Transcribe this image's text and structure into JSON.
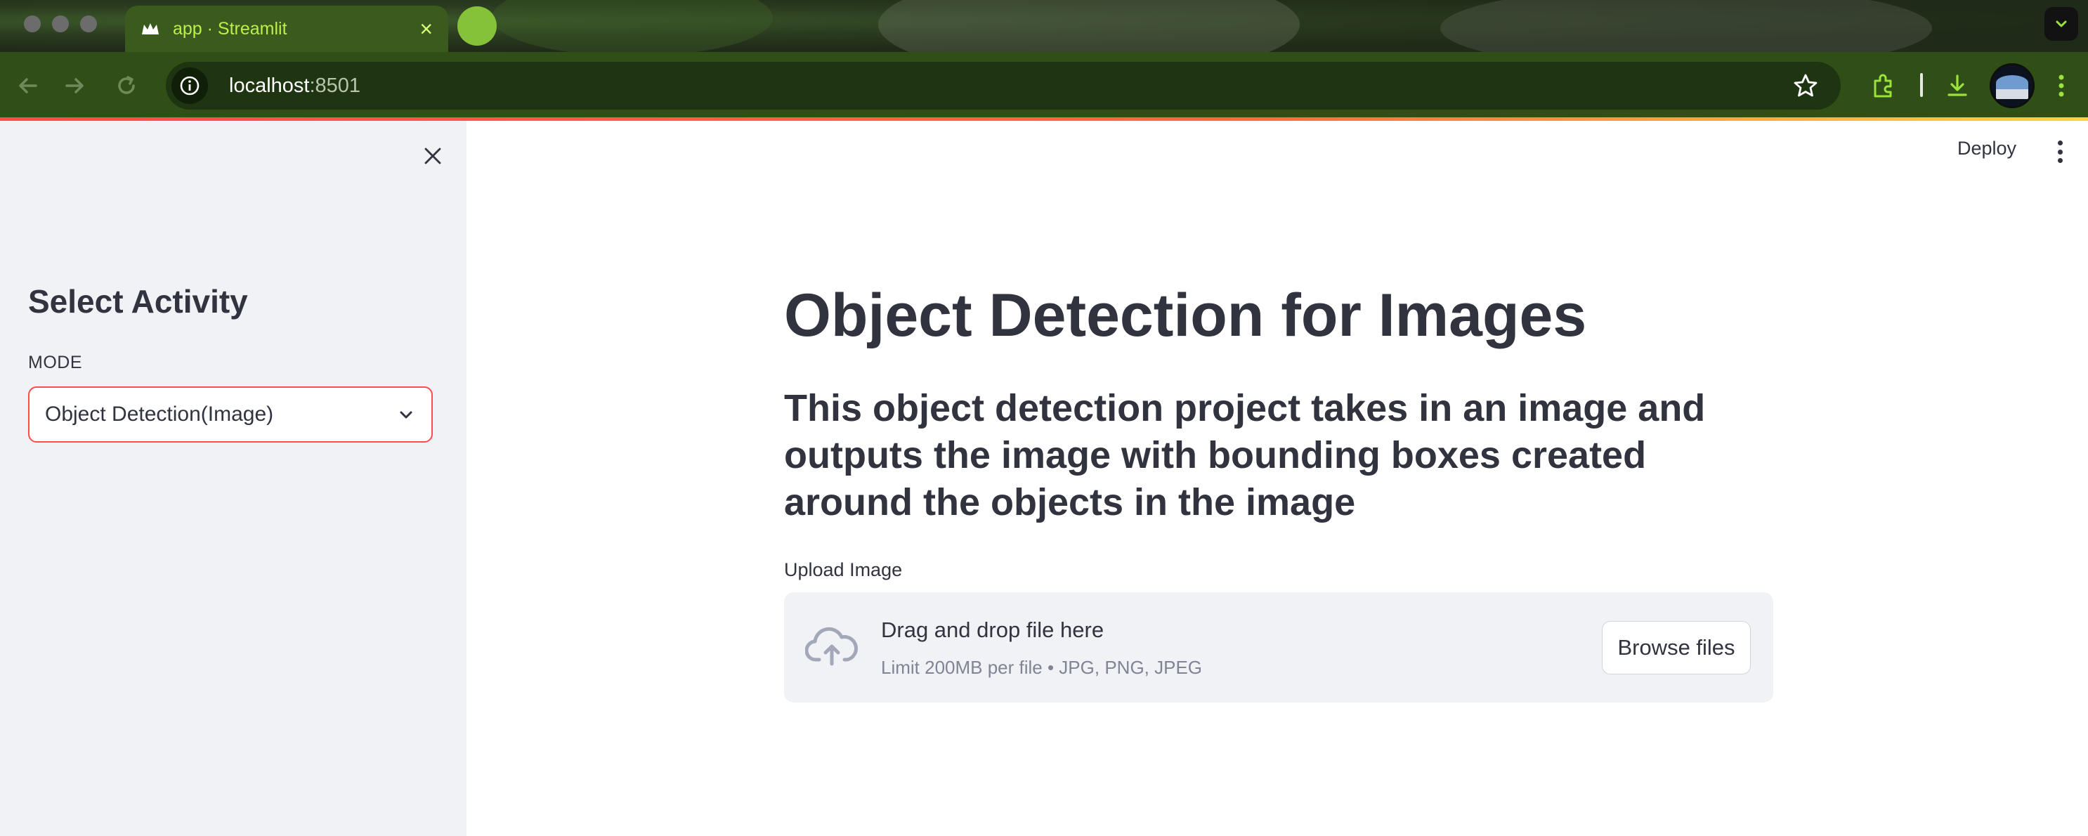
{
  "browser": {
    "tab_title": "app · Streamlit",
    "tab_close": "×",
    "url_host": "localhost",
    "url_port": ":8501",
    "icons": [
      "back-arrow-icon",
      "forward-arrow-icon",
      "reload-icon",
      "site-info-icon",
      "star-icon",
      "extensions-icon",
      "download-icon",
      "profile-avatar",
      "browser-menu-icon",
      "tab-search-chevron-icon"
    ]
  },
  "sidebar": {
    "title": "Select Activity",
    "mode_label": "MODE",
    "mode_selected": "Object Detection(Image)",
    "accent_color": "#ff4b4b"
  },
  "header": {
    "deploy_label": "Deploy"
  },
  "main": {
    "title": "Object Detection for Images",
    "subtitle": "This object detection project takes in an image and outputs the image with bounding boxes created around the objects in the image",
    "upload_label": "Upload Image",
    "dropzone": {
      "primary": "Drag and drop file here",
      "secondary": "Limit 200MB per file • JPG, PNG, JPEG",
      "browse_label": "Browse files"
    }
  }
}
